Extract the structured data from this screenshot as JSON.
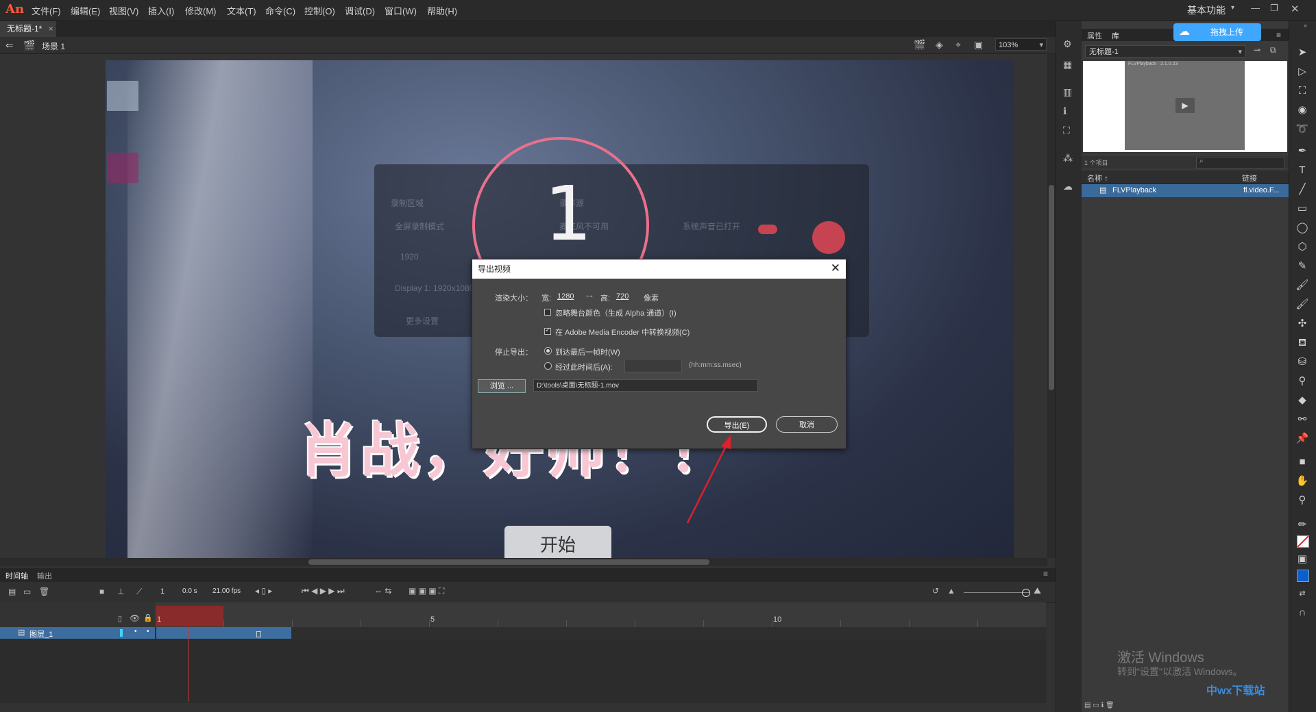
{
  "app": {
    "logo": "An",
    "workspace": "基本功能"
  },
  "menu": [
    "文件(F)",
    "编辑(E)",
    "视图(V)",
    "插入(I)",
    "修改(M)",
    "文本(T)",
    "命令(C)",
    "控制(O)",
    "调试(D)",
    "窗口(W)",
    "帮助(H)"
  ],
  "document": {
    "tab": "无标题-1*",
    "scene": "场景 1",
    "zoom": "103%"
  },
  "stage": {
    "recorder_labels": [
      "录制区域",
      "全屏录制模式",
      "录声源",
      "麦克风不可用",
      "系统声音已打开",
      "1920",
      "Display 1: 1920x1080",
      "更多设置"
    ],
    "countdown": "1",
    "headline": "肖战，好帅！！",
    "start_button": "开始"
  },
  "dialog": {
    "title": "导出视频",
    "render_size_label": "渲染大小：",
    "width_label": "宽:",
    "width_value": "1280",
    "height_label": "高:",
    "height_value": "720",
    "unit": "像素",
    "ignore_stage_color": "忽略舞台颜色（生成 Alpha 通道）(I)",
    "convert_in_ame": "在 Adobe Media Encoder 中转换视频(C)",
    "stop_export_label": "停止导出：",
    "option_last_frame": "到达最后一帧时(W)",
    "option_after_time": "经过此时间后(A):",
    "time_format": "(hh:mm:ss.msec)",
    "browse": "浏览 ...",
    "path": "D:\\tools\\桌面\\无标题-1.mov",
    "export": "导出(E)",
    "cancel": "取消",
    "ignore_checked": false,
    "ame_checked": true
  },
  "timeline": {
    "tabs": [
      "时间轴",
      "输出"
    ],
    "frame": "1",
    "time": "0.0 s",
    "fps": "21.00 fps",
    "layer": "图层_1",
    "ruler": [
      "1",
      "5",
      "10"
    ]
  },
  "library": {
    "tabs": [
      "属性",
      "库"
    ],
    "upload": "拖拽上传",
    "document_select": "无标题-1",
    "preview_label": "FLVPlayback · 2.1.0.23",
    "count": "1 个项目",
    "col_name": "名称",
    "col_linkage": "链接",
    "item_name": "FLVPlayback",
    "item_linkage": "fl.video.F..."
  },
  "windows": {
    "activate_title": "激活 Windows",
    "activate_sub": "转到\"设置\"以激活 Windows。"
  },
  "watermark": "中wx下载站",
  "colors": {
    "accent": "#3fa7ff",
    "layer_selected": "#3d6d9e",
    "playhead": "#c43a3a",
    "annotation_arrow": "#e0202a"
  }
}
